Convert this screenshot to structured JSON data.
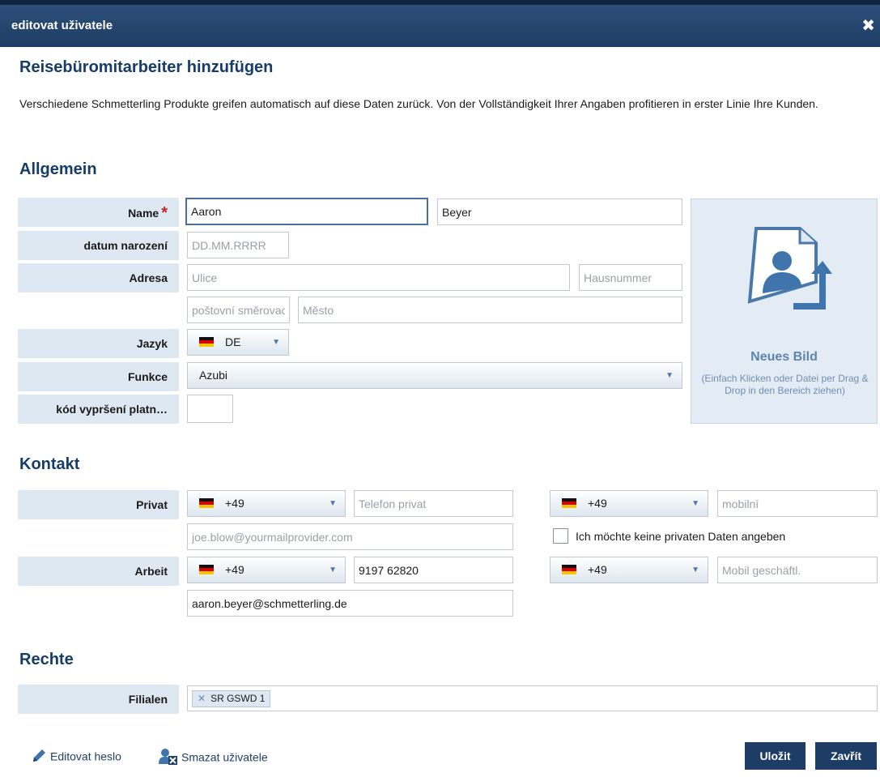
{
  "window": {
    "title": "editovat uživatele"
  },
  "heading": "Reisebüromitarbeiter hinzufügen",
  "intro": "Verschiedene Schmetterling Produkte greifen automatisch auf diese Daten zurück. Von der Vollständigkeit Ihrer Angaben profitieren in erster Linie Ihre Kunden.",
  "sections": {
    "general": "Allgemein",
    "contact": "Kontakt",
    "rights": "Rechte"
  },
  "general": {
    "name_label": "Name",
    "required_mark": "*",
    "first_name": "Aaron",
    "last_name": "Beyer",
    "birthdate_label": "datum narození",
    "birthdate_placeholder": "DD.MM.RRRR",
    "address_label": "Adresa",
    "street_placeholder": "Ulice",
    "house_number_placeholder": "Hausnummer",
    "postal_placeholder": "poštovní směrovací číslo",
    "city_placeholder": "Město",
    "language_label": "Jazyk",
    "language_value": "DE",
    "function_label": "Funkce",
    "function_value": "Azubi",
    "expiry_label": "kód vypršení platn…",
    "expiry_value": ""
  },
  "photo": {
    "title": "Neues Bild",
    "hint": "(Einfach Klicken oder Datei per Drag & Drop in den Bereich ziehen)"
  },
  "contact": {
    "private_label": "Privat",
    "private_phone_code": "+49",
    "private_phone_placeholder": "Telefon privat",
    "private_mobile_code": "+49",
    "private_mobile_placeholder": "mobilní",
    "private_email_placeholder": "joe.blow@yourmailprovider.com",
    "no_private_data_label": "Ich möchte keine privaten Daten angeben",
    "work_label": "Arbeit",
    "work_phone_code": "+49",
    "work_phone_value": "9197 62820",
    "work_mobile_code": "+49",
    "work_mobile_placeholder": "Mobil geschäftl.",
    "work_email_value": "aaron.beyer@schmetterling.de"
  },
  "rights": {
    "branches_label": "Filialen",
    "branches": [
      "SR GSWD 1"
    ]
  },
  "footer": {
    "edit_password": "Editovat heslo",
    "delete_user": "Smazat uživatele",
    "save": "Uložit",
    "close": "Zavřít"
  },
  "colors": {
    "titlebar": "#1e3d63",
    "label_bg": "#dde8f3",
    "heading": "#173c68",
    "button": "#1d3d66"
  }
}
